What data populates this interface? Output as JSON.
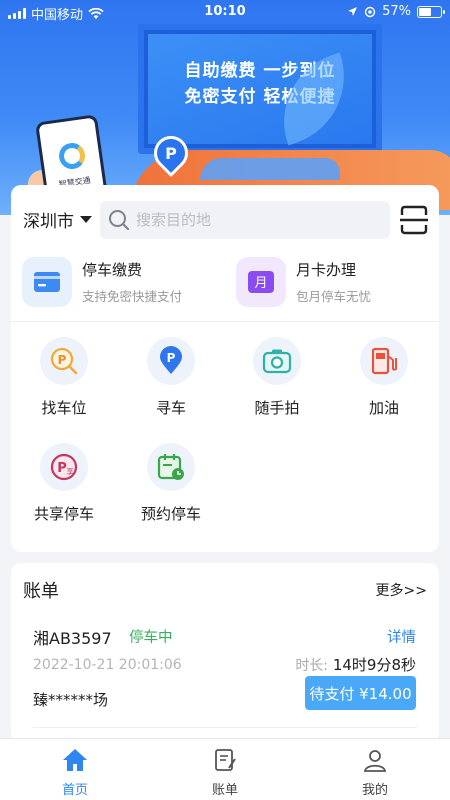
{
  "status_bar": {
    "carrier": "中国移动",
    "time": "10:10",
    "battery": "57%",
    "battery_level": 0.57
  },
  "banner": {
    "line1": "自助缴费 一步到位",
    "line2": "免密支付 轻松便捷",
    "pin_letter": "P",
    "phone_brand": "智慧交通"
  },
  "location": {
    "city": "深圳市"
  },
  "search": {
    "placeholder": "搜索目的地",
    "value": ""
  },
  "services": [
    {
      "title": "停车缴费",
      "subtitle": "支持免密快捷支付",
      "icon": "card-icon",
      "color": "#3d8bf2"
    },
    {
      "title": "月卡办理",
      "subtitle": "包月停车无忧",
      "icon": "month-card-icon",
      "badge": "月",
      "color": "#8a4cf0"
    }
  ],
  "grid": [
    {
      "label": "找车位",
      "icon": "find-parking-icon"
    },
    {
      "label": "寻车",
      "icon": "find-car-icon"
    },
    {
      "label": "随手拍",
      "icon": "camera-icon"
    },
    {
      "label": "加油",
      "icon": "fuel-icon"
    },
    {
      "label": "共享停车",
      "icon": "shared-parking-icon"
    },
    {
      "label": "预约停车",
      "icon": "reserve-parking-icon"
    }
  ],
  "bill": {
    "title": "账单",
    "more": "更多>>",
    "plate": "湘AB3597",
    "status": "停车中",
    "detail": "详情",
    "time": "2022-10-21 20:01:06",
    "duration_label": "时长:",
    "duration": "14时9分8秒",
    "lot": "臻******场",
    "pay_label": "待支付 ¥14.00"
  },
  "tabs": [
    {
      "label": "首页",
      "icon": "home-icon",
      "active": true
    },
    {
      "label": "账单",
      "icon": "bill-icon",
      "active": false
    },
    {
      "label": "我的",
      "icon": "profile-icon",
      "active": false
    }
  ],
  "colors": {
    "primary": "#2f86f0",
    "green": "#34b15e",
    "pay_button": "#4aa8f8"
  }
}
